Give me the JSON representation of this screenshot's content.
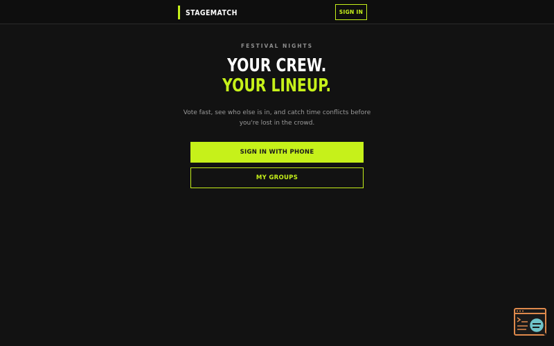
{
  "header": {
    "brand": "STAGEMATCH",
    "signin_label": "SIGN IN"
  },
  "hero": {
    "eyebrow": "FESTIVAL NIGHTS",
    "headline_line1": "YOUR CREW.",
    "headline_line2": "YOUR LINEUP.",
    "subcopy": "Vote fast, see who else is in, and catch time conflicts before you're lost in the crowd."
  },
  "actions": {
    "primary_label": "SIGN IN WITH PHONE",
    "secondary_label": "MY GROUPS"
  },
  "widget": {
    "icon": "inspect-window-icon"
  },
  "colors": {
    "background": "#121212",
    "accent": "#c6f11a",
    "text_primary": "#ffffff",
    "text_muted": "#9a9a9a",
    "widget_orange": "#e08a4c",
    "widget_teal": "#6fc3c8"
  }
}
